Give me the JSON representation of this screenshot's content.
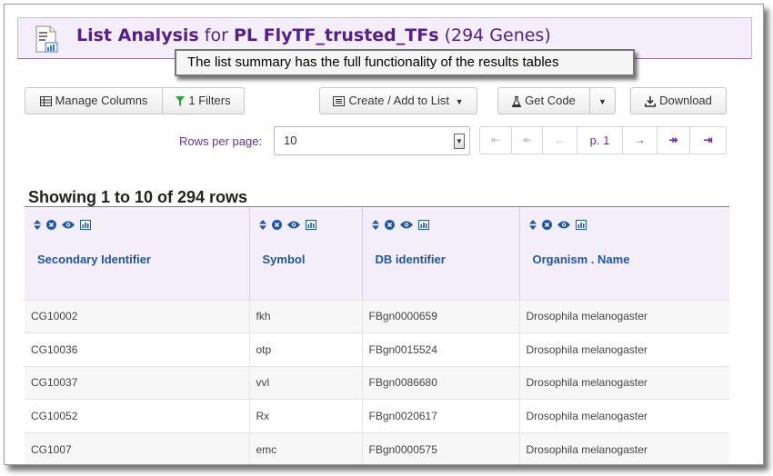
{
  "header": {
    "title_main": "List Analysis",
    "title_for": "for",
    "list_name": "PL FlyTF_trusted_TFs",
    "count": "(294 Genes)",
    "icon": "list-analysis-icon"
  },
  "callout": {
    "text": "The list summary has the full functionality of the results tables"
  },
  "toolbar": {
    "manage_columns": "Manage Columns",
    "filters": "1 Filters",
    "create_list": "Create / Add to List",
    "get_code": "Get Code",
    "download": "Download"
  },
  "pagination": {
    "rows_per_page_label": "Rows per page:",
    "rows_per_page_value": "10",
    "page_label": "p. 1"
  },
  "summary": {
    "showing_text": "Showing 1 to 10 of 294 rows"
  },
  "table": {
    "columns": [
      "Secondary Identifier",
      "Symbol",
      "DB identifier",
      "Organism . Name"
    ],
    "rows": [
      [
        "CG10002",
        "fkh",
        "FBgn0000659",
        "Drosophila melanogaster"
      ],
      [
        "CG10036",
        "otp",
        "FBgn0015524",
        "Drosophila melanogaster"
      ],
      [
        "CG10037",
        "vvl",
        "FBgn0086680",
        "Drosophila melanogaster"
      ],
      [
        "CG10052",
        "Rx",
        "FBgn0020617",
        "Drosophila melanogaster"
      ],
      [
        "CG1007",
        "emc",
        "FBgn0000575",
        "Drosophila melanogaster"
      ]
    ]
  },
  "colors": {
    "accent": "#55208a",
    "header_bg": "#f3eefa",
    "column_title": "#1d57a5",
    "filter_green": "#2e9e3a"
  }
}
